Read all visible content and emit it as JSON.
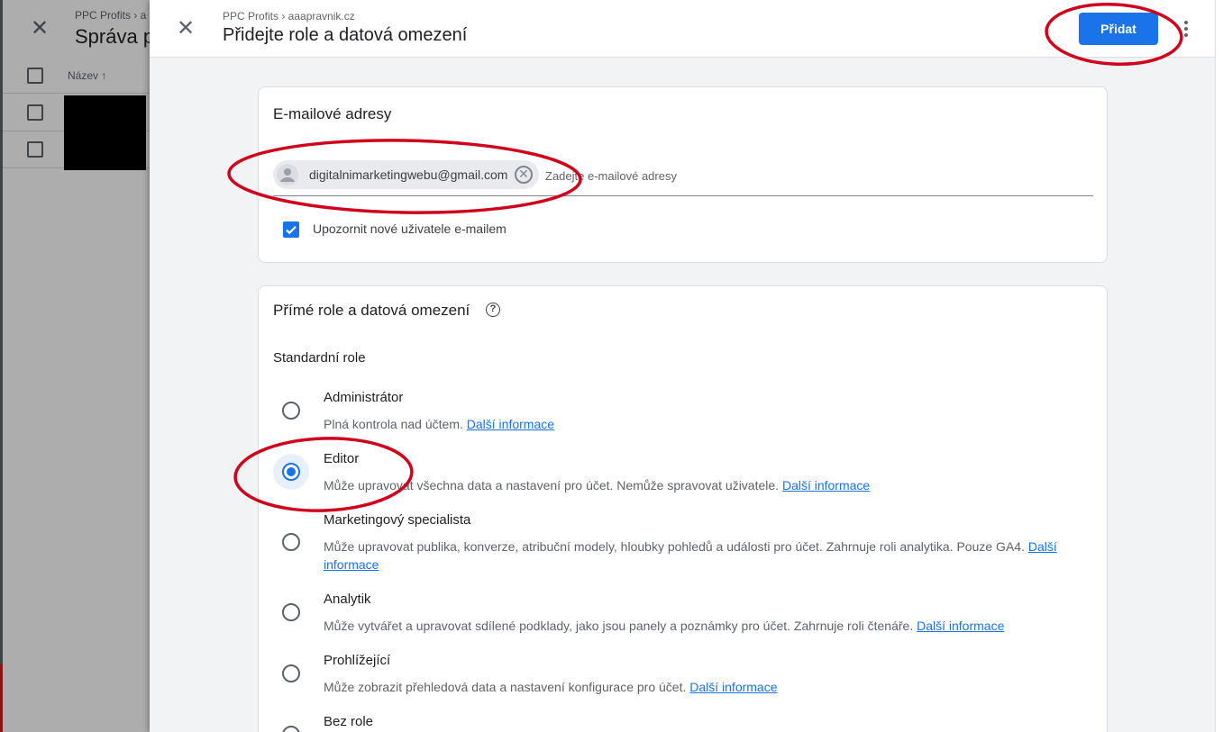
{
  "background": {
    "breadcrumb": "PPC Profits › a",
    "title": "Správa p",
    "column_name": "Název ↑"
  },
  "drawer": {
    "breadcrumb": "PPC Profits › aaapravnik.cz",
    "title": "Přidejte role a datová omezení",
    "add_button": "Přidat"
  },
  "email_card": {
    "title": "E-mailové adresy",
    "chip_email": "digitalnimarketingwebu@gmail.com",
    "input_placeholder": "Zadejte e-mailové adresy",
    "notify_label": "Upozornit nové uživatele e-mailem",
    "notify_checked": true
  },
  "roles_card": {
    "title": "Přímé role a datová omezení",
    "section_label": "Standardní role",
    "link_text": "Další informace",
    "roles": [
      {
        "name": "Administrátor",
        "desc": "Plná kontrola nad účtem.",
        "link": "Další informace",
        "checked": false
      },
      {
        "name": "Editor",
        "desc": "Může upravovat všechna data a nastavení pro účet. Nemůže spravovat uživatele.",
        "link": "Další informace",
        "checked": true
      },
      {
        "name": "Marketingový specialista",
        "desc": "Může upravovat publika, konverze, atribuční modely, hloubky pohledů a události pro účet. Zahrnuje roli analytika. Pouze GA4.",
        "link": "Další informace",
        "checked": false
      },
      {
        "name": "Analytik",
        "desc": "Může vytvářet a upravovat sdílené podklady, jako jsou panely a poznámky pro účet. Zahrnuje roli čtenáře.",
        "link": "Další informace",
        "checked": false
      },
      {
        "name": "Prohlížející",
        "desc": "Může zobrazit přehledová data a nastavení konfigurace pro účet.",
        "link": "Další informace",
        "checked": false
      },
      {
        "name": "Bez role",
        "desc": "",
        "link": "",
        "checked": false
      }
    ]
  },
  "colors": {
    "accent": "#1a73e8",
    "annotation": "#d0021b"
  }
}
